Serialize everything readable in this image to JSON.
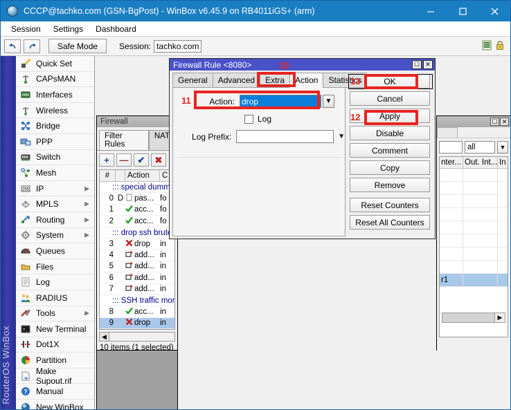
{
  "window": {
    "title": "CCCP@tachko.com (GSN-BgPost) - WinBox v6.45.9 on RB4011iGS+ (arm)",
    "icon": "winbox-globe-icon",
    "minimize": "minimize-button",
    "maximize": "maximize-button",
    "close": "close-button"
  },
  "menubar": {
    "items": [
      {
        "label": "Session"
      },
      {
        "label": "Settings"
      },
      {
        "label": "Dashboard"
      }
    ]
  },
  "toolbar": {
    "undo_icon": "undo-icon",
    "redo_icon": "redo-icon",
    "safe_mode": "Safe Mode",
    "session_label": "Session:",
    "session_value": "tachko.com",
    "signal_icon": "signal-bars-icon",
    "lock_icon": "lock-icon"
  },
  "sidebar": {
    "brand": "RouterOS WinBox",
    "items": [
      {
        "label": "Quick Set",
        "icon": "quick-set-icon",
        "arrow": false
      },
      {
        "label": "CAPsMAN",
        "icon": "capsman-icon",
        "arrow": false
      },
      {
        "label": "Interfaces",
        "icon": "interfaces-icon",
        "arrow": false
      },
      {
        "label": "Wireless",
        "icon": "wireless-icon",
        "arrow": false
      },
      {
        "label": "Bridge",
        "icon": "bridge-icon",
        "arrow": false
      },
      {
        "label": "PPP",
        "icon": "ppp-icon",
        "arrow": false
      },
      {
        "label": "Switch",
        "icon": "switch-icon",
        "arrow": false
      },
      {
        "label": "Mesh",
        "icon": "mesh-icon",
        "arrow": false
      },
      {
        "label": "IP",
        "icon": "ip-icon",
        "arrow": true
      },
      {
        "label": "MPLS",
        "icon": "mpls-icon",
        "arrow": true
      },
      {
        "label": "Routing",
        "icon": "routing-icon",
        "arrow": true
      },
      {
        "label": "System",
        "icon": "system-icon",
        "arrow": true
      },
      {
        "label": "Queues",
        "icon": "queues-icon",
        "arrow": false
      },
      {
        "label": "Files",
        "icon": "files-icon",
        "arrow": false
      },
      {
        "label": "Log",
        "icon": "log-icon",
        "arrow": false
      },
      {
        "label": "RADIUS",
        "icon": "radius-icon",
        "arrow": false
      },
      {
        "label": "Tools",
        "icon": "tools-icon",
        "arrow": true
      },
      {
        "label": "New Terminal",
        "icon": "new-terminal-icon",
        "arrow": false
      },
      {
        "label": "Dot1X",
        "icon": "dot1x-icon",
        "arrow": false
      },
      {
        "label": "Partition",
        "icon": "partition-icon",
        "arrow": false
      },
      {
        "label": "Make Supout.rif",
        "icon": "make-supout-icon",
        "arrow": false
      },
      {
        "label": "Manual",
        "icon": "manual-icon",
        "arrow": false
      },
      {
        "label": "New WinBox",
        "icon": "new-winbox-icon",
        "arrow": false
      }
    ]
  },
  "firewall_window": {
    "title": "Firewall",
    "tabs": [
      {
        "label": "Filter Rules",
        "active": true
      },
      {
        "label": "NAT",
        "active": false
      }
    ],
    "toolbar_buttons": [
      {
        "name": "add-rule-button",
        "glyph": "+"
      },
      {
        "name": "remove-rule-button",
        "glyph": "—"
      },
      {
        "name": "enable-rule-button",
        "glyph": "✔"
      },
      {
        "name": "disable-rule-button",
        "glyph": "✖"
      }
    ],
    "columns": [
      "#",
      "",
      "Action",
      "C"
    ],
    "rows": [
      {
        "type": "comment",
        "text": "::: special dummy n"
      },
      {
        "type": "rule",
        "num": "0",
        "flag": "D",
        "action": "pas...",
        "action_icon": "passthrough-icon",
        "chain": "fo"
      },
      {
        "type": "rule",
        "num": "1",
        "flag": "",
        "action": "acc...",
        "action_icon": "accept-icon",
        "chain": "fo"
      },
      {
        "type": "rule",
        "num": "2",
        "flag": "",
        "action": "acc...",
        "action_icon": "accept-icon",
        "chain": "fo"
      },
      {
        "type": "comment",
        "text": "::: drop ssh brute fo"
      },
      {
        "type": "rule",
        "num": "3",
        "flag": "",
        "action": "drop",
        "action_icon": "drop-icon",
        "chain": "in"
      },
      {
        "type": "rule",
        "num": "4",
        "flag": "",
        "action": "add...",
        "action_icon": "add-list-icon",
        "chain": "in"
      },
      {
        "type": "rule",
        "num": "5",
        "flag": "",
        "action": "add...",
        "action_icon": "add-list-icon",
        "chain": "in"
      },
      {
        "type": "rule",
        "num": "6",
        "flag": "",
        "action": "add...",
        "action_icon": "add-list-icon",
        "chain": "in"
      },
      {
        "type": "rule",
        "num": "7",
        "flag": "",
        "action": "add...",
        "action_icon": "add-list-icon",
        "chain": "in"
      },
      {
        "type": "comment",
        "text": "::: SSH traffic moni"
      },
      {
        "type": "rule",
        "num": "8",
        "flag": "",
        "action": "acc...",
        "action_icon": "accept-icon",
        "chain": "in"
      },
      {
        "type": "rule",
        "num": "9",
        "flag": "",
        "action": "drop",
        "action_icon": "drop-icon",
        "chain": "in",
        "selected": true
      }
    ],
    "status": "10 items (1 selected)"
  },
  "right_window": {
    "filter_value": "all",
    "columns": [
      "nter...",
      "Out. Int...",
      "In"
    ],
    "selected_cell": "r1",
    "maximize": "maximize-button",
    "close": "close-button"
  },
  "rule_dialog": {
    "title": "Firewall Rule <8080>",
    "maximize": "maximize-button",
    "close": "close-button",
    "tabs": [
      {
        "label": "General",
        "active": false
      },
      {
        "label": "Advanced",
        "active": false
      },
      {
        "label": "Extra",
        "active": false
      },
      {
        "label": "Action",
        "active": true
      },
      {
        "label": "Statistics",
        "active": false
      }
    ],
    "action_label": "Action:",
    "action_value": "drop",
    "log_label": "Log",
    "log_checked": false,
    "log_prefix_label": "Log Prefix:",
    "log_prefix_value": "",
    "buttons": [
      {
        "label": "OK"
      },
      {
        "label": "Cancel"
      },
      {
        "label": "Apply"
      },
      {
        "label": "Disable"
      },
      {
        "label": "Comment"
      },
      {
        "label": "Copy"
      },
      {
        "label": "Remove"
      },
      {
        "label": "Reset Counters"
      },
      {
        "label": "Reset All Counters"
      }
    ]
  },
  "annotations": {
    "color": "#e8241f",
    "markers": [
      {
        "id": "10",
        "target": "action-tab"
      },
      {
        "id": "11",
        "target": "action-field"
      },
      {
        "id": "12",
        "target": "apply-button"
      },
      {
        "id": "13",
        "target": "ok-button"
      }
    ]
  }
}
